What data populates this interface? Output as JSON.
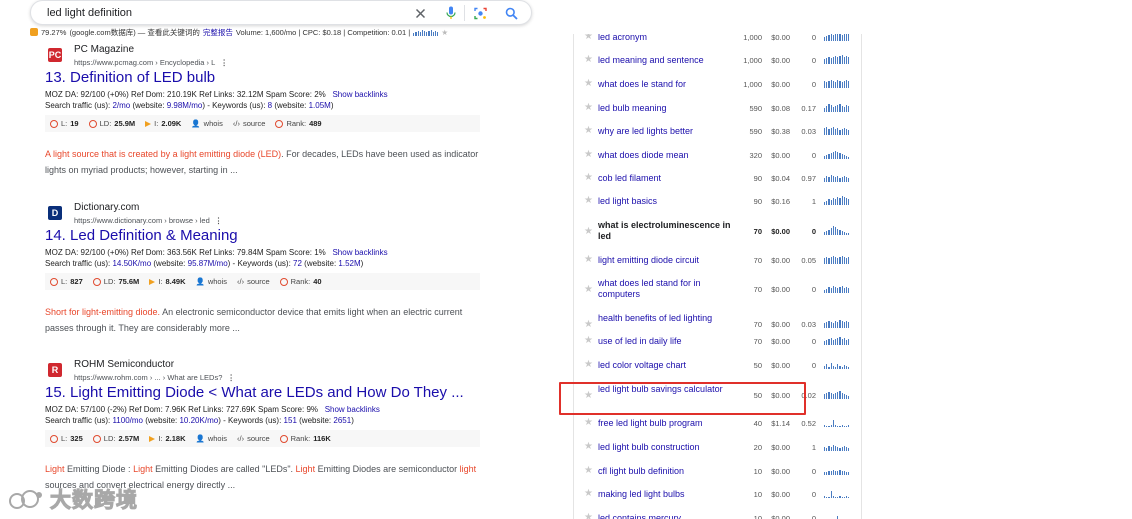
{
  "search": {
    "query": "led light definition"
  },
  "seo_bar": {
    "percent": "79.27%",
    "source": "(google.com数据库) — 查看此关键词的",
    "report_link": "完整报告",
    "metrics": "Volume: 1,600/mo | CPC: $0.18 | Competition: 0.01 |"
  },
  "results": [
    {
      "site_name": "PC Magazine",
      "site_url": "https://www.pcmag.com › Encyclopedia › L",
      "favicon_text": "PC",
      "favicon_color": "#d0282f",
      "number": "13.",
      "title": "Definition of LED bulb",
      "moz_line1": "MOZ DA: 92/100 (+0%)   Ref Dom: 210.19K   Ref Links: 32.12M   Spam Score: 2%",
      "backlinks": "Show backlinks",
      "traffic_prefix": "Search traffic (us):",
      "traffic_us": "2/mo",
      "traffic_web_prefix": "(website:",
      "traffic_web": "9.98M/mo",
      "kw_prefix": ") - Keywords (us):",
      "kw_us": "8",
      "kw_web_prefix": "(website:",
      "kw_web": "1.05M",
      "kw_end": ")",
      "stats": {
        "l": "19",
        "ld": "25.9M",
        "i": "2.09K",
        "whois": "whois",
        "source": "source",
        "rank_label": "Rank:",
        "rank": "489"
      },
      "snippet_hl": "A light source that is created by a light emitting diode (LED)",
      "snippet_rest": ". For decades, LEDs have been used as indicator lights on myriad products; however, starting in ..."
    },
    {
      "site_name": "Dictionary.com",
      "site_url": "https://www.dictionary.com › browse › led",
      "favicon_text": "D",
      "favicon_color": "#0a2f7a",
      "number": "14.",
      "title": "Led Definition & Meaning",
      "moz_line1": "MOZ DA: 92/100 (+0%)   Ref Dom: 363.56K   Ref Links: 79.84M   Spam Score: 1%",
      "backlinks": "Show backlinks",
      "traffic_prefix": "Search traffic (us):",
      "traffic_us": "14.50K/mo",
      "traffic_web_prefix": "(website:",
      "traffic_web": "95.87M/mo",
      "kw_prefix": ") - Keywords (us):",
      "kw_us": "72",
      "kw_web_prefix": "(website:",
      "kw_web": "1.52M",
      "kw_end": ")",
      "stats": {
        "l": "827",
        "ld": "75.6M",
        "i": "8.49K",
        "whois": "whois",
        "source": "source",
        "rank_label": "Rank:",
        "rank": "40"
      },
      "snippet_hl": "Short for light-emitting diode.",
      "snippet_rest": " An electronic semiconductor device that emits light when an electric current passes through it. They are considerably more ..."
    },
    {
      "site_name": "ROHM Semiconductor",
      "site_url": "https://www.rohm.com › ... › What are LEDs?",
      "favicon_text": "R",
      "favicon_color": "#d0282f",
      "number": "15.",
      "title": "Light Emitting Diode  < What are LEDs and How Do They ...",
      "moz_line1": "MOZ DA: 57/100 (-2%)   Ref Dom: 7.96K   Ref Links: 727.69K   Spam Score: 9%",
      "backlinks": "Show backlinks",
      "traffic_prefix": "Search traffic (us):",
      "traffic_us": "1100/mo",
      "traffic_web_prefix": "(website:",
      "traffic_web": "10.20K/mo",
      "kw_prefix": ") - Keywords (us):",
      "kw_us": "151",
      "kw_web_prefix": "(website:",
      "kw_web": "2651",
      "kw_end": ")",
      "stats": {
        "l": "325",
        "ld": "2.57M",
        "i": "2.18K",
        "whois": "whois",
        "source": "source",
        "rank_label": "Rank:",
        "rank": "116K"
      },
      "snippet_parts": [
        {
          "t": "Light",
          "hl": true
        },
        {
          "t": " Emitting Diode : ",
          "hl": false
        },
        {
          "t": "Light",
          "hl": true
        },
        {
          "t": " Emitting Diodes are called \"LEDs\". ",
          "hl": false
        },
        {
          "t": "Light",
          "hl": true
        },
        {
          "t": " Emitting Diodes are semiconductor ",
          "hl": false
        },
        {
          "t": "light",
          "hl": true
        },
        {
          "t": " sources and convert electrical energy directly ...",
          "hl": false
        }
      ]
    }
  ],
  "keywords": [
    {
      "kw": "led acronym",
      "vol": "1,000",
      "cpc": "$0.00",
      "comp": "0"
    },
    {
      "kw": "led meaning and sentence",
      "vol": "1,000",
      "cpc": "$0.00",
      "comp": "0"
    },
    {
      "kw": "what does le stand for",
      "vol": "1,000",
      "cpc": "$0.00",
      "comp": "0"
    },
    {
      "kw": "led bulb meaning",
      "vol": "590",
      "cpc": "$0.08",
      "comp": "0.17"
    },
    {
      "kw": "why are led lights better",
      "vol": "590",
      "cpc": "$0.38",
      "comp": "0.03"
    },
    {
      "kw": "what does diode mean",
      "vol": "320",
      "cpc": "$0.00",
      "comp": "0"
    },
    {
      "kw": "cob led filament",
      "vol": "90",
      "cpc": "$0.04",
      "comp": "0.97"
    },
    {
      "kw": "led light basics",
      "vol": "90",
      "cpc": "$0.16",
      "comp": "1"
    },
    {
      "kw": "what is electroluminescence in led",
      "vol": "70",
      "cpc": "$0.00",
      "comp": "0",
      "bold": true
    },
    {
      "kw": "light emitting diode circuit",
      "vol": "70",
      "cpc": "$0.00",
      "comp": "0.05"
    },
    {
      "kw": "what does led stand for in computers",
      "vol": "70",
      "cpc": "$0.00",
      "comp": "0"
    },
    {
      "kw": "health benefits of led lighting",
      "vol": "70",
      "cpc": "$0.00",
      "comp": "0.03"
    },
    {
      "kw": "use of led in daily life",
      "vol": "70",
      "cpc": "$0.00",
      "comp": "0"
    },
    {
      "kw": "led color voltage chart",
      "vol": "50",
      "cpc": "$0.00",
      "comp": "0"
    },
    {
      "kw": "led light bulb savings calculator",
      "vol": "50",
      "cpc": "$0.00",
      "comp": "0.02"
    },
    {
      "kw": "free led light bulb program",
      "vol": "40",
      "cpc": "$1.14",
      "comp": "0.52"
    },
    {
      "kw": "led light bulb construction",
      "vol": "20",
      "cpc": "$0.00",
      "comp": "1"
    },
    {
      "kw": "cfl light bulb definition",
      "vol": "10",
      "cpc": "$0.00",
      "comp": "0"
    },
    {
      "kw": "making led light bulbs",
      "vol": "10",
      "cpc": "$0.00",
      "comp": "0"
    },
    {
      "kw": "led contains mercury",
      "vol": "10",
      "cpc": "$0.00",
      "comp": "0"
    }
  ],
  "watermark": {
    "text": "大数跨境"
  }
}
